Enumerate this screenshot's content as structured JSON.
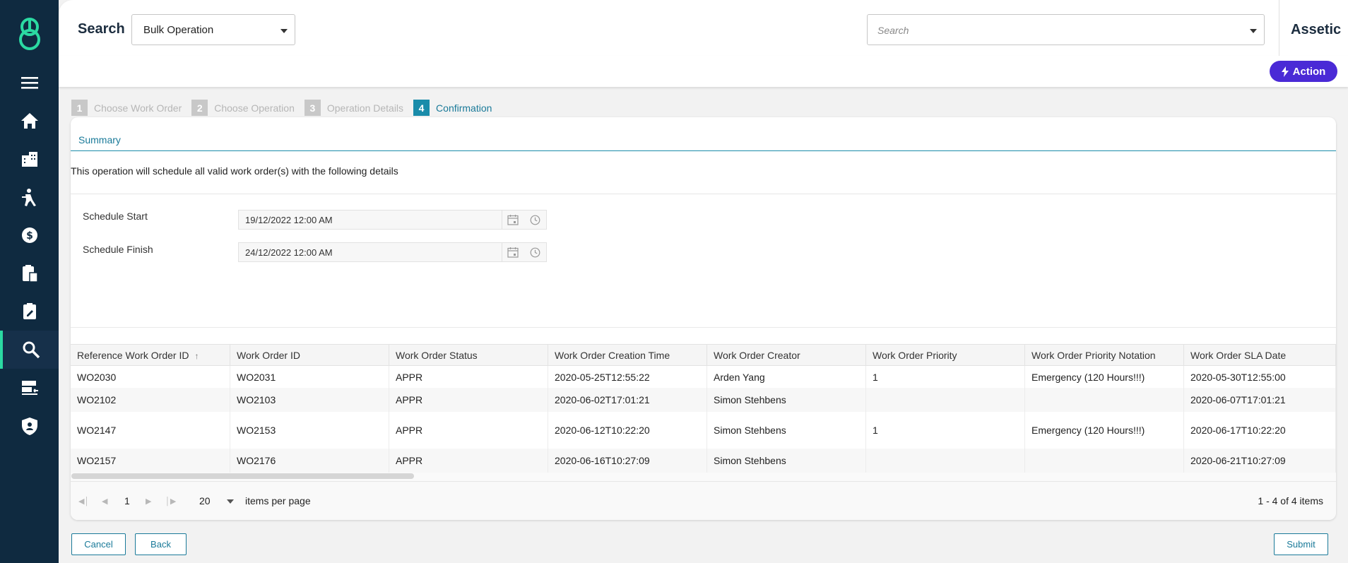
{
  "header": {
    "title": "Search",
    "select_value": "Bulk Operation",
    "search_placeholder": "Search",
    "brand": "Assetic"
  },
  "action_bar": {
    "action_label": "Action"
  },
  "steps": [
    {
      "num": "1",
      "label": "Choose Work Order"
    },
    {
      "num": "2",
      "label": "Choose Operation"
    },
    {
      "num": "3",
      "label": "Operation Details"
    },
    {
      "num": "4",
      "label": "Confirmation"
    }
  ],
  "summary": {
    "title": "Summary",
    "description": "This operation will schedule all valid work order(s) with the following details",
    "schedule_start_label": "Schedule Start",
    "schedule_start_value": "19/12/2022 12:00 AM",
    "schedule_finish_label": "Schedule Finish",
    "schedule_finish_value": "24/12/2022 12:00 AM"
  },
  "grid": {
    "columns": [
      "Reference Work Order ID",
      "Work Order ID",
      "Work Order Status",
      "Work Order Creation Time",
      "Work Order Creator",
      "Work Order Priority",
      "Work Order Priority Notation",
      "Work Order SLA Date"
    ],
    "sort_indicator": "↑",
    "rows": [
      [
        "WO2030",
        "WO2031",
        "APPR",
        "2020-05-25T12:55:22",
        "Arden Yang",
        "1",
        "Emergency (120 Hours!!!)",
        "2020-05-30T12:55:00"
      ],
      [
        "WO2102",
        "WO2103",
        "APPR",
        "2020-06-02T17:01:21",
        "Simon Stehbens",
        "",
        "",
        "2020-06-07T17:01:21"
      ],
      [
        "WO2147",
        "WO2153",
        "APPR",
        "2020-06-12T10:22:20",
        "Simon Stehbens",
        "1",
        "Emergency (120 Hours!!!)",
        "2020-06-17T10:22:20"
      ],
      [
        "WO2157",
        "WO2176",
        "APPR",
        "2020-06-16T10:27:09",
        "Simon Stehbens",
        "",
        "",
        "2020-06-21T10:27:09"
      ]
    ]
  },
  "pager": {
    "page": "1",
    "page_size": "20",
    "items_per_page_label": "items per page",
    "info": "1 - 4 of 4 items"
  },
  "buttons": {
    "cancel": "Cancel",
    "back": "Back",
    "submit": "Submit"
  },
  "colors": {
    "sidebar": "#0f2a40",
    "accent_teal": "#1a8caa",
    "action_purple": "#4a2ad6",
    "logo_green": "#2bd9a2"
  }
}
